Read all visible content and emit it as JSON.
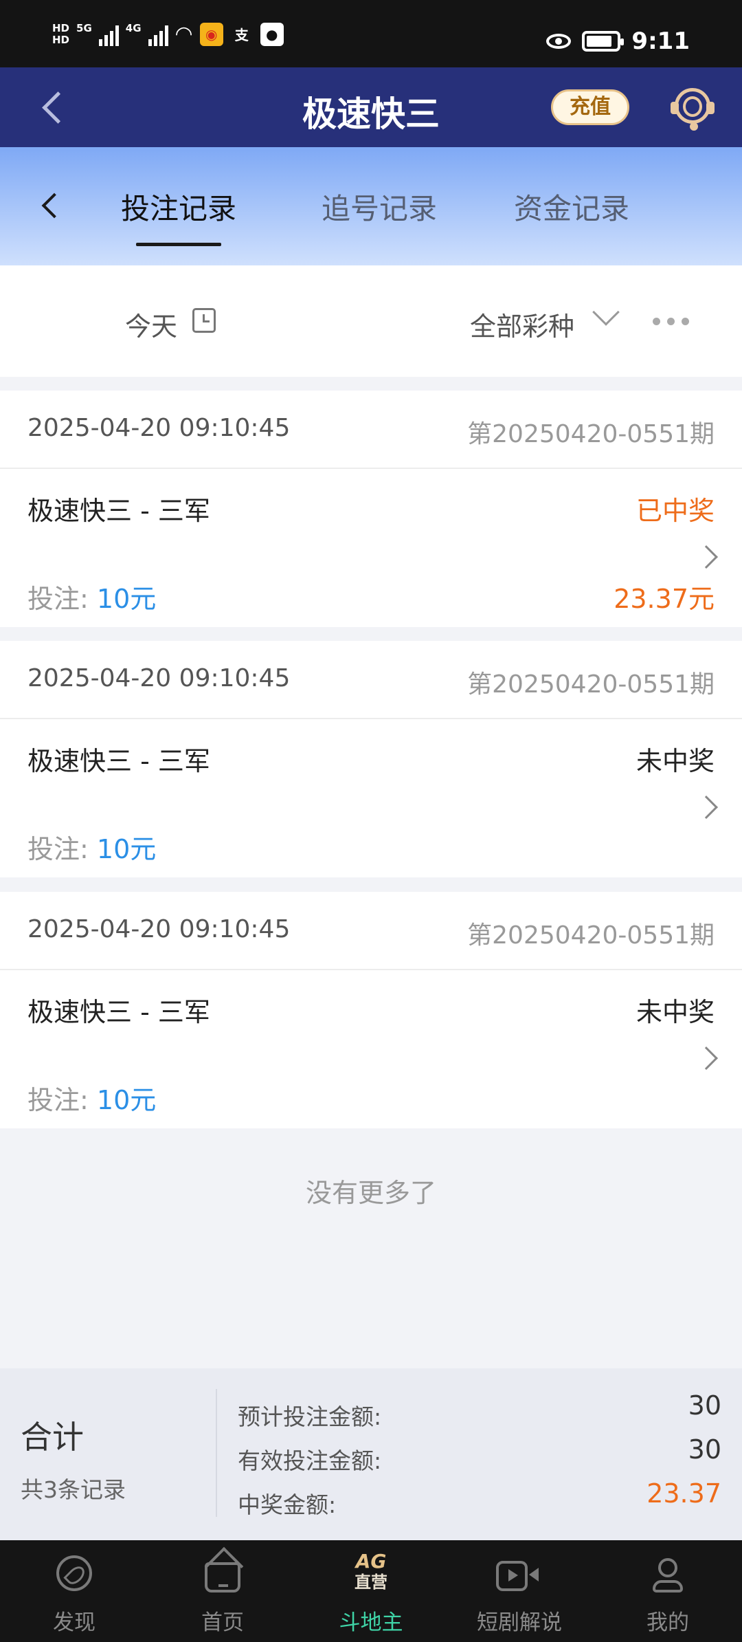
{
  "status_bar": {
    "hd1": "HD",
    "hd2": "HD",
    "net1": "5G",
    "net2": "4G",
    "alipay": "支",
    "time": "9:11",
    "battery_level": 0.85
  },
  "header": {
    "title": "极速快三",
    "recharge_label": "充值"
  },
  "tabs": [
    {
      "label": "投注记录",
      "active": true
    },
    {
      "label": "追号记录",
      "active": false
    },
    {
      "label": "资金记录",
      "active": false
    }
  ],
  "filter": {
    "date_label": "今天",
    "type_label": "全部彩种"
  },
  "records": [
    {
      "time": "2025-04-20 09:10:45",
      "issue": "第20250420-0551期",
      "name": "极速快三 - 三军",
      "status": "已中奖",
      "bet_label": "投注: ",
      "bet_amount": "10元",
      "win_amount": "23.37元"
    },
    {
      "time": "2025-04-20 09:10:45",
      "issue": "第20250420-0551期",
      "name": "极速快三 - 三军",
      "status": "未中奖",
      "bet_label": "投注: ",
      "bet_amount": "10元",
      "win_amount": ""
    },
    {
      "time": "2025-04-20 09:10:45",
      "issue": "第20250420-0551期",
      "name": "极速快三 - 三军",
      "status": "未中奖",
      "bet_label": "投注: ",
      "bet_amount": "10元",
      "win_amount": ""
    }
  ],
  "no_more_text": "没有更多了",
  "summary": {
    "title": "合计",
    "count": "共3条记录",
    "expected_label": "预计投注金额:",
    "expected_value": "30",
    "valid_label": "有效投注金额:",
    "valid_value": "30",
    "win_label": "中奖金额:",
    "win_value": "23.37"
  },
  "bottom_nav": [
    {
      "label": "发现",
      "icon": "compass-icon",
      "active": false
    },
    {
      "label": "首页",
      "icon": "home-icon",
      "active": false
    },
    {
      "label": "斗地主",
      "icon": "ag-direct-icon",
      "active": true,
      "icon_text": "AG",
      "icon_sub": "直营"
    },
    {
      "label": "短剧解说",
      "icon": "video-icon",
      "active": false
    },
    {
      "label": "我的",
      "icon": "user-icon",
      "active": false
    }
  ],
  "colors": {
    "header_bg": "#27307a",
    "win_orange": "#ee6c1a",
    "bet_blue": "#2b8fe6",
    "nav_active": "#3fd4a7"
  }
}
